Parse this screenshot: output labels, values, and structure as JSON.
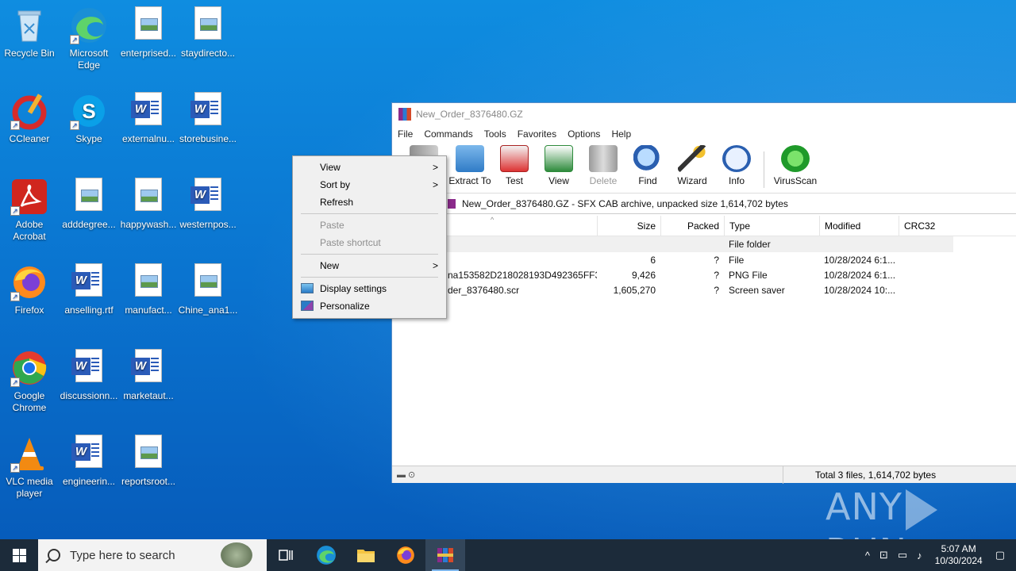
{
  "desktop": {
    "icons": [
      {
        "label": "Recycle Bin"
      },
      {
        "label": "Microsoft Edge"
      },
      {
        "label": "enterprised..."
      },
      {
        "label": "staydirecto..."
      },
      {
        "label": "CCleaner"
      },
      {
        "label": "Skype"
      },
      {
        "label": "externalnu..."
      },
      {
        "label": "storebusine..."
      },
      {
        "label": "Adobe Acrobat"
      },
      {
        "label": "adddegree..."
      },
      {
        "label": "happywash..."
      },
      {
        "label": "westernpos..."
      },
      {
        "label": "Firefox"
      },
      {
        "label": "anselling.rtf"
      },
      {
        "label": "manufact..."
      },
      {
        "label": "Chine_ana1..."
      },
      {
        "label": "Google Chrome"
      },
      {
        "label": "discussionn..."
      },
      {
        "label": "marketaut..."
      },
      {
        "label": "VLC media player"
      },
      {
        "label": "engineerin..."
      },
      {
        "label": "reportsroot..."
      }
    ]
  },
  "winrar": {
    "title": "New_Order_8376480.GZ",
    "menu": [
      "File",
      "Commands",
      "Tools",
      "Favorites",
      "Options",
      "Help"
    ],
    "toolbar": [
      "Extract To",
      "Test",
      "View",
      "Delete",
      "Find",
      "Wizard",
      "Info",
      "VirusScan"
    ],
    "path": "New_Order_8376480.GZ - SFX CAB archive, unpacked size 1,614,702 bytes",
    "columns": {
      "size": "Size",
      "packed": "Packed",
      "type": "Type",
      "modified": "Modified",
      "crc": "CRC32"
    },
    "rows": [
      {
        "name": "",
        "size": "",
        "packed": "",
        "type": "File folder",
        "modified": ""
      },
      {
        "name": "",
        "size": "6",
        "packed": "?",
        "type": "File",
        "modified": "10/28/2024 6:1..."
      },
      {
        "name": "na153582D218028193D492365FF38...",
        "size": "9,426",
        "packed": "?",
        "type": "PNG File",
        "modified": "10/28/2024 6:1..."
      },
      {
        "name": "der_8376480.scr",
        "size": "1,605,270",
        "packed": "?",
        "type": "Screen saver",
        "modified": "10/28/2024 10:..."
      }
    ],
    "status": "Total 3 files, 1,614,702 bytes"
  },
  "context_menu": {
    "items": {
      "view": "View",
      "sort_by": "Sort by",
      "refresh": "Refresh",
      "paste": "Paste",
      "paste_shortcut": "Paste shortcut",
      "new": "New",
      "display_settings": "Display settings",
      "personalize": "Personalize"
    }
  },
  "watermark": {
    "left": "ANY",
    "right": "RUN"
  },
  "taskbar": {
    "search_placeholder": "Type here to search",
    "time": "5:07 AM",
    "date": "10/30/2024"
  }
}
